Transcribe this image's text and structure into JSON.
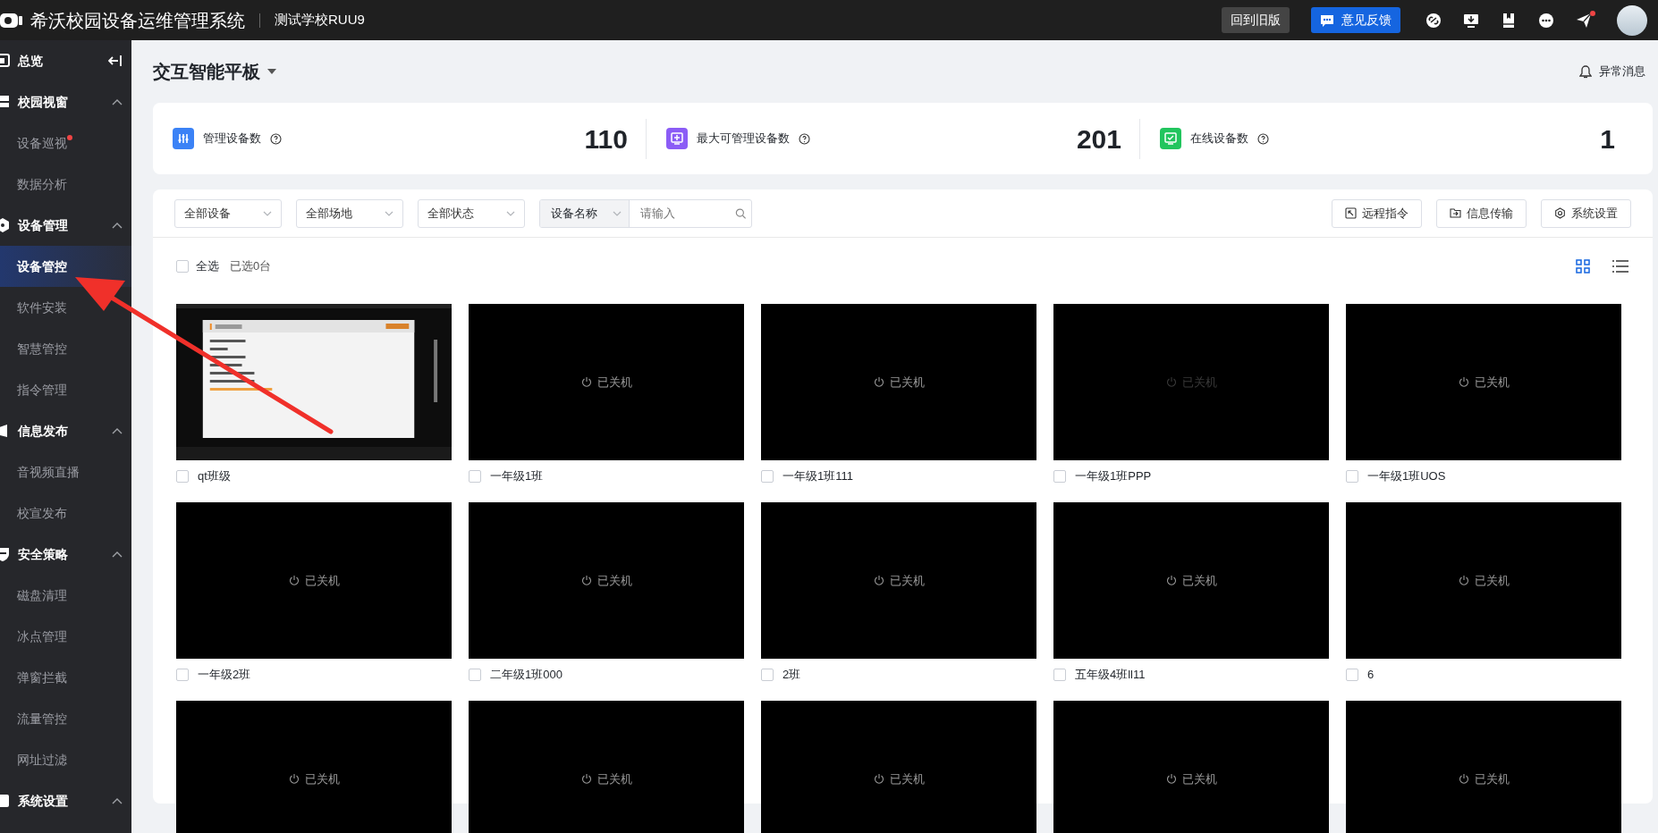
{
  "header": {
    "title": "希沃校园设备运维管理系统",
    "school": "测试学校RUU9",
    "buttons": [
      {
        "label": "回到旧版",
        "kind": "dark"
      },
      {
        "label": "意见反馈",
        "kind": "primary"
      }
    ],
    "icons": [
      {
        "kind": "link",
        "dot": false
      },
      {
        "kind": "download",
        "dot": false
      },
      {
        "kind": "book",
        "dot": false
      },
      {
        "kind": "more",
        "dot": false
      },
      {
        "kind": "send",
        "dot": true
      }
    ]
  },
  "sidebar": {
    "items": [
      {
        "label": "总览",
        "kind": "link"
      },
      {
        "label": "校园视窗",
        "kind": "group",
        "expanded": true,
        "children": [
          {
            "label": "设备巡视",
            "selected": false,
            "dot": true
          },
          {
            "label": "数据分析",
            "selected": false,
            "dot": false
          }
        ]
      },
      {
        "label": "设备管理",
        "kind": "group",
        "expanded": true,
        "children": [
          {
            "label": "设备管控",
            "selected": true,
            "dot": false
          },
          {
            "label": "软件安装",
            "selected": false,
            "dot": false
          },
          {
            "label": "智慧管控",
            "selected": false,
            "dot": false
          },
          {
            "label": "指令管理",
            "selected": false,
            "dot": false
          }
        ]
      },
      {
        "label": "信息发布",
        "kind": "group",
        "expanded": true,
        "children": [
          {
            "label": "音视频直播",
            "selected": false,
            "dot": false
          },
          {
            "label": "校宣发布",
            "selected": false,
            "dot": false
          }
        ]
      },
      {
        "label": "安全策略",
        "kind": "group",
        "expanded": true,
        "children": [
          {
            "label": "磁盘清理",
            "selected": false,
            "dot": false
          },
          {
            "label": "冰点管理",
            "selected": false,
            "dot": false
          },
          {
            "label": "弹窗拦截",
            "selected": false,
            "dot": false
          },
          {
            "label": "流量管控",
            "selected": false,
            "dot": false
          },
          {
            "label": "网址过滤",
            "selected": false,
            "dot": false
          }
        ]
      },
      {
        "label": "系统设置",
        "kind": "group",
        "expanded": true
      }
    ]
  },
  "page": {
    "title": "交互智能平板",
    "alerts": "异常消息"
  },
  "stats": [
    {
      "label": "管理设备数",
      "value": "110",
      "color": "#3b82f6"
    },
    {
      "label": "最大可管理设备数",
      "value": "201",
      "color": "#8b5cf6"
    },
    {
      "label": "在线设备数",
      "value": "1",
      "color": "#22c55e"
    }
  ],
  "filters": {
    "selects": [
      "全部设备",
      "全部场地",
      "全部状态"
    ],
    "search": {
      "field": "设备名称",
      "placeholder": "请输入"
    },
    "actions": [
      {
        "label": "远程指令",
        "kind": "command"
      },
      {
        "label": "信息传输",
        "kind": "transfer"
      },
      {
        "label": "系统设置",
        "kind": "settings"
      }
    ]
  },
  "selection": {
    "label": "全选",
    "checked": false,
    "count": "已选0台"
  },
  "views": [
    {
      "kind": "grid",
      "selected": true
    },
    {
      "kind": "list",
      "selected": false
    }
  ],
  "devices": [
    {
      "kind": "screen",
      "name": "qt班级",
      "checked": false
    },
    {
      "kind": "off",
      "status": "已关机",
      "faded": false,
      "name": "一年级1班",
      "checked": false
    },
    {
      "kind": "off",
      "status": "已关机",
      "faded": false,
      "name": "一年级1班111",
      "checked": false
    },
    {
      "kind": "off",
      "status": "已关机",
      "faded": true,
      "name": "一年级1班PPP",
      "checked": false
    },
    {
      "kind": "off",
      "status": "已关机",
      "faded": false,
      "name": "一年级1班UOS",
      "checked": false
    },
    {
      "kind": "off",
      "status": "已关机",
      "faded": false,
      "name": "一年级2班",
      "checked": false
    },
    {
      "kind": "off",
      "status": "已关机",
      "faded": false,
      "name": "二年级1班000",
      "checked": false
    },
    {
      "kind": "off",
      "status": "已关机",
      "faded": false,
      "name": "2班",
      "checked": false
    },
    {
      "kind": "off",
      "status": "已关机",
      "faded": false,
      "name": "五年级4班ll11",
      "checked": false
    },
    {
      "kind": "off",
      "status": "已关机",
      "faded": false,
      "name": "6",
      "checked": false
    },
    {
      "kind": "off",
      "status": "已关机",
      "faded": false
    },
    {
      "kind": "off",
      "status": "已关机",
      "faded": false
    },
    {
      "kind": "off",
      "status": "已关机",
      "faded": false
    },
    {
      "kind": "off",
      "status": "已关机",
      "faded": false
    },
    {
      "kind": "off",
      "status": "已关机",
      "faded": false
    }
  ]
}
